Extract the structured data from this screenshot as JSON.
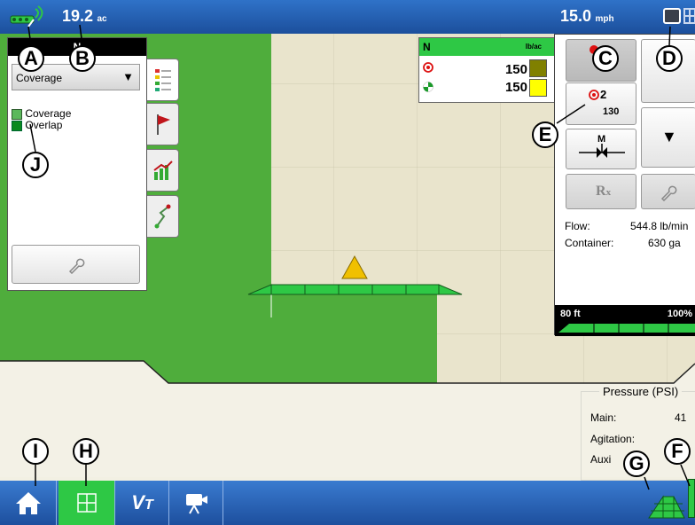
{
  "topbar": {
    "area_value": "19.2",
    "area_unit": "ac",
    "speed_value": "15.0",
    "speed_unit": "mph"
  },
  "map_legend": {
    "mode_header": "N",
    "dropdown_value": "Coverage",
    "legend": [
      {
        "label": "Coverage",
        "color": "#5cb85c"
      },
      {
        "label": "Overlap",
        "color": "#0a8a1e"
      }
    ]
  },
  "rate_table": {
    "header_label": "N",
    "header_unit": "lb/ac",
    "rows": [
      {
        "icon": "target-rate-icon",
        "value": "150",
        "bar_color": "#808000"
      },
      {
        "icon": "actual-rate-icon",
        "value": "150",
        "bar_color": "#ffff00"
      }
    ]
  },
  "control_panel": {
    "preset_label": "2",
    "preset_value": "130",
    "manual_label": "M",
    "rx_label": "R",
    "flow_label": "Flow:",
    "flow_value": "544.8 lb/min",
    "container_label": "Container:",
    "container_value": "630 ga",
    "boom_width": "80 ft",
    "boom_percent": "100%"
  },
  "pressure": {
    "title": "Pressure (PSI)",
    "main_label": "Main:",
    "main_value": "41",
    "agitation_label": "Agitation:",
    "aux_label": "Auxi"
  },
  "callouts": [
    "A",
    "B",
    "C",
    "D",
    "E",
    "F",
    "G",
    "H",
    "I",
    "J"
  ],
  "colors": {
    "field_green": "#4fad3c",
    "bar_blue": "#2563b4",
    "active_green": "#2ec845"
  }
}
